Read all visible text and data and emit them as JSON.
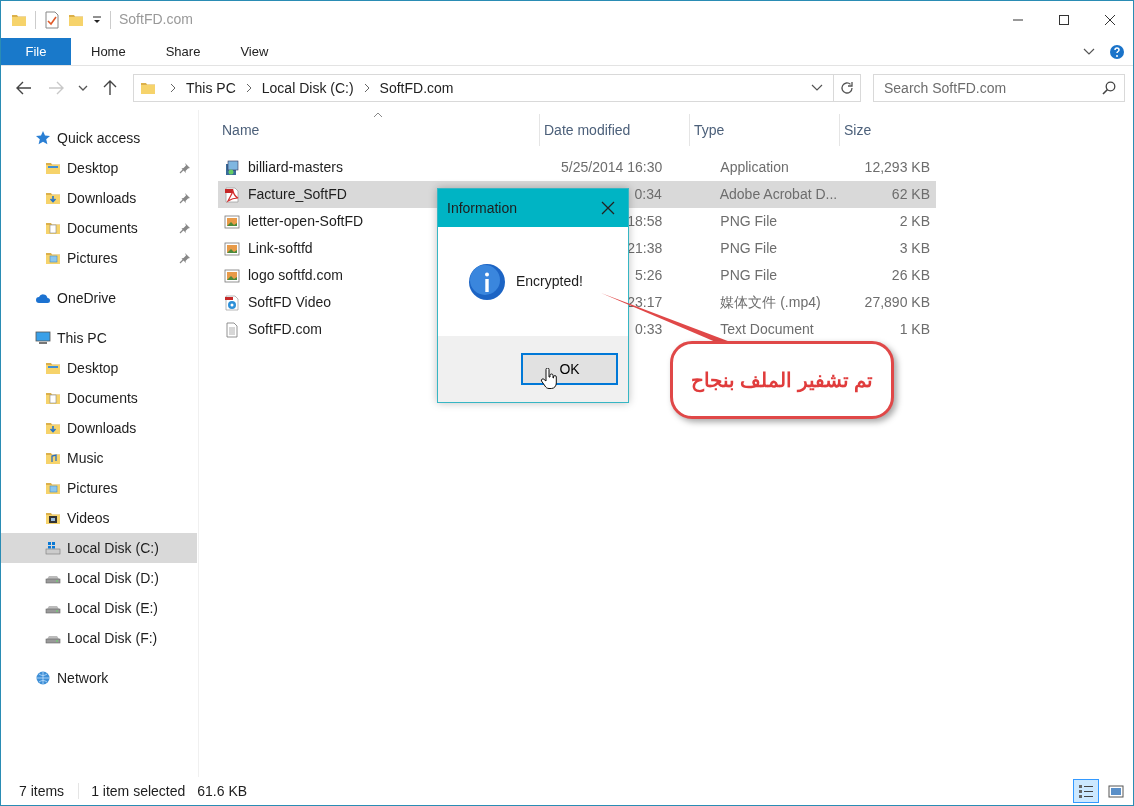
{
  "window": {
    "title": "SoftFD.com"
  },
  "file_menu": {
    "label": "File"
  },
  "ribbon_tabs": [
    {
      "label": "Home"
    },
    {
      "label": "Share"
    },
    {
      "label": "View"
    }
  ],
  "address_bar": {
    "path": [
      "This PC",
      "Local Disk (C:)",
      "SoftFD.com"
    ]
  },
  "search": {
    "placeholder": "Search SoftFD.com"
  },
  "sidebar": {
    "items": [
      {
        "label": "Quick access",
        "kind": "star",
        "selected": false,
        "children": [
          {
            "label": "Desktop",
            "kind": "desktop",
            "pinned": true,
            "selected": false
          },
          {
            "label": "Downloads",
            "kind": "downloads",
            "pinned": true,
            "selected": false
          },
          {
            "label": "Documents",
            "kind": "documents",
            "pinned": true,
            "selected": false
          },
          {
            "label": "Pictures",
            "kind": "pictures",
            "pinned": true,
            "selected": false
          }
        ]
      },
      {
        "label": "OneDrive",
        "kind": "cloud",
        "selected": false
      },
      {
        "label": "This PC",
        "kind": "pc",
        "selected": false,
        "children": [
          {
            "label": "Desktop",
            "kind": "desktop",
            "selected": false
          },
          {
            "label": "Documents",
            "kind": "documents",
            "selected": false
          },
          {
            "label": "Downloads",
            "kind": "downloads",
            "selected": false
          },
          {
            "label": "Music",
            "kind": "music",
            "selected": false
          },
          {
            "label": "Pictures",
            "kind": "pictures",
            "selected": false
          },
          {
            "label": "Videos",
            "kind": "videos",
            "selected": false
          },
          {
            "label": "Local Disk (C:)",
            "kind": "system-drive",
            "selected": true
          },
          {
            "label": "Local Disk (D:)",
            "kind": "drive",
            "selected": false
          },
          {
            "label": "Local Disk (E:)",
            "kind": "drive",
            "selected": false
          },
          {
            "label": "Local Disk (F:)",
            "kind": "drive",
            "selected": false
          }
        ]
      },
      {
        "label": "Network",
        "kind": "network",
        "selected": false
      }
    ]
  },
  "table": {
    "columns": [
      "Name",
      "Date modified",
      "Type",
      "Size"
    ],
    "rows": [
      {
        "kind": "app",
        "name": "billiard-masters",
        "date": "5/25/2014 16:30",
        "type": "Application",
        "size": "12,293 KB",
        "selected": false
      },
      {
        "kind": "pdf",
        "name": "Facture_SoftFD",
        "date": "0:34",
        "type": "Adobe Acrobat D...",
        "size": "62 KB",
        "selected": true
      },
      {
        "kind": "png",
        "name": "letter-open-SoftFD",
        "date": "18:58",
        "type": "PNG File",
        "size": "2 KB",
        "selected": false
      },
      {
        "kind": "png",
        "name": "Link-softfd",
        "date": "21:38",
        "type": "PNG File",
        "size": "3 KB",
        "selected": false
      },
      {
        "kind": "png",
        "name": "logo softfd.com",
        "date": "5:26",
        "type": "PNG File",
        "size": "26 KB",
        "selected": false
      },
      {
        "kind": "video",
        "name": "SoftFD Video",
        "date": "23:17",
        "type": "媒体文件 (.mp4)",
        "size": "27,890 KB",
        "selected": false
      },
      {
        "kind": "text",
        "name": "SoftFD.com",
        "date": "0:33",
        "type": "Text Document",
        "size": "1 KB",
        "selected": false
      }
    ]
  },
  "status_bar": {
    "item_count": "7 items",
    "selection": "1 item selected",
    "selection_size": "61.6 KB"
  },
  "view_buttons": [
    {
      "kind": "details",
      "selected": true
    },
    {
      "kind": "large-icons",
      "selected": false
    }
  ],
  "dialog": {
    "title": "Information",
    "message": "Encrypted!",
    "button": "OK"
  },
  "annotation": {
    "text": "تم تشفير الملف بنجاح"
  }
}
